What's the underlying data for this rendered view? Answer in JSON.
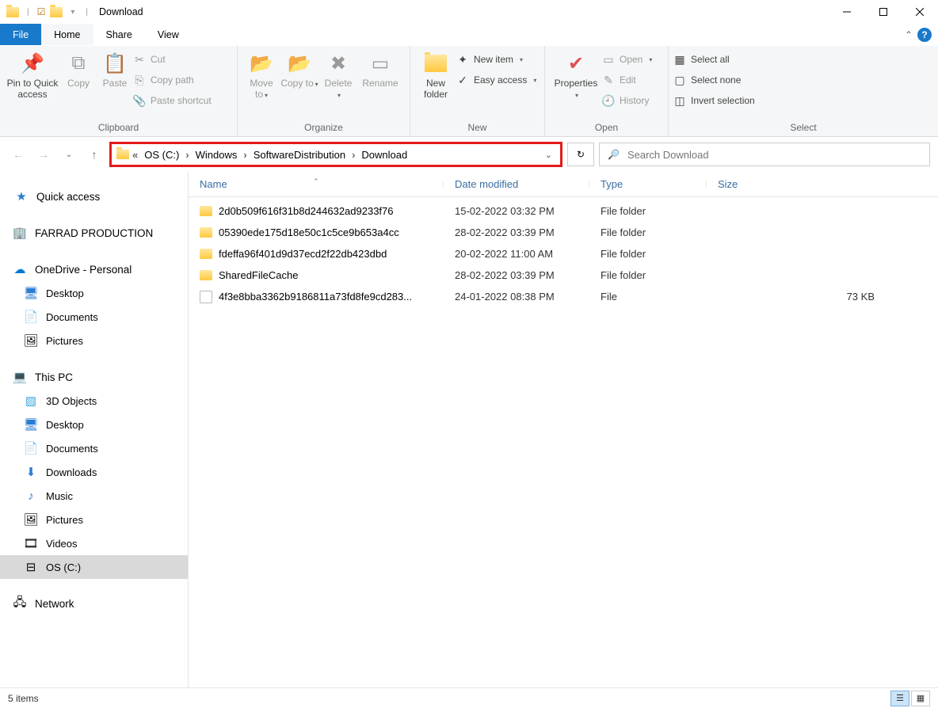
{
  "window": {
    "title": "Download"
  },
  "tabs": {
    "file": "File",
    "home": "Home",
    "share": "Share",
    "view": "View"
  },
  "ribbon": {
    "clipboard": {
      "label": "Clipboard",
      "pin": "Pin to Quick access",
      "copy": "Copy",
      "paste": "Paste",
      "cut": "Cut",
      "copy_path": "Copy path",
      "paste_shortcut": "Paste shortcut"
    },
    "organize": {
      "label": "Organize",
      "move": "Move to",
      "copy": "Copy to",
      "delete": "Delete",
      "rename": "Rename"
    },
    "new": {
      "label": "New",
      "new_folder": "New folder",
      "new_item": "New item",
      "easy_access": "Easy access"
    },
    "open": {
      "label": "Open",
      "properties": "Properties",
      "open": "Open",
      "edit": "Edit",
      "history": "History"
    },
    "select": {
      "label": "Select",
      "select_all": "Select all",
      "select_none": "Select none",
      "invert": "Invert selection"
    }
  },
  "breadcrumb": {
    "segments": [
      "OS (C:)",
      "Windows",
      "SoftwareDistribution",
      "Download"
    ]
  },
  "search": {
    "placeholder": "Search Download"
  },
  "sidebar": {
    "quick_access": "Quick access",
    "farrad": "FARRAD PRODUCTION",
    "onedrive": "OneDrive - Personal",
    "od_children": [
      "Desktop",
      "Documents",
      "Pictures"
    ],
    "this_pc": "This PC",
    "pc_children": [
      "3D Objects",
      "Desktop",
      "Documents",
      "Downloads",
      "Music",
      "Pictures",
      "Videos",
      "OS (C:)"
    ],
    "network": "Network"
  },
  "columns": {
    "name": "Name",
    "date": "Date modified",
    "type": "Type",
    "size": "Size"
  },
  "files": [
    {
      "name": "2d0b509f616f31b8d244632ad9233f76",
      "date": "15-02-2022 03:32 PM",
      "type": "File folder",
      "size": "",
      "kind": "folder"
    },
    {
      "name": "05390ede175d18e50c1c5ce9b653a4cc",
      "date": "28-02-2022 03:39 PM",
      "type": "File folder",
      "size": "",
      "kind": "folder"
    },
    {
      "name": "fdeffa96f401d9d37ecd2f22db423dbd",
      "date": "20-02-2022 11:00 AM",
      "type": "File folder",
      "size": "",
      "kind": "folder"
    },
    {
      "name": "SharedFileCache",
      "date": "28-02-2022 03:39 PM",
      "type": "File folder",
      "size": "",
      "kind": "folder"
    },
    {
      "name": "4f3e8bba3362b9186811a73fd8fe9cd283...",
      "date": "24-01-2022 08:38 PM",
      "type": "File",
      "size": "73 KB",
      "kind": "file"
    }
  ],
  "status": {
    "count": "5 items"
  }
}
